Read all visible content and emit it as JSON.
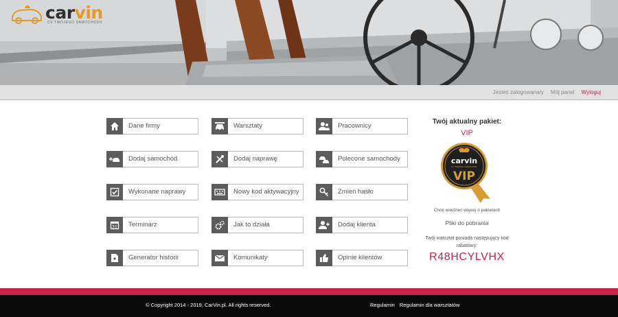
{
  "brand": {
    "name_prefix": "car",
    "name_accent": "vin",
    "tagline": "CV TWOJEGO SAMOCHODU"
  },
  "userbar": {
    "logged_in": "Jesteś zalogowana/y",
    "my_panel": "Mój panel",
    "logout": "Wyloguj"
  },
  "tiles": [
    {
      "label": "Dane firmy",
      "icon": "home-icon"
    },
    {
      "label": "Warsztaty",
      "icon": "car-service-icon"
    },
    {
      "label": "Pracownicy",
      "icon": "users-icon"
    },
    {
      "label": "Dodaj samochód",
      "icon": "add-car-icon"
    },
    {
      "label": "Dodaj naprawę",
      "icon": "tools-icon"
    },
    {
      "label": "Polecone samochody",
      "icon": "cars-icon"
    },
    {
      "label": "Wykonane naprawy",
      "icon": "checklist-icon"
    },
    {
      "label": "Nowy kod aktywacyjny",
      "icon": "keyboard-icon"
    },
    {
      "label": "Zmień hasło",
      "icon": "key-icon"
    },
    {
      "label": "Terminarz",
      "icon": "calendar-icon"
    },
    {
      "label": "Jak to działa",
      "icon": "gears-icon"
    },
    {
      "label": "Dodaj klienta",
      "icon": "add-user-icon"
    },
    {
      "label": "Generator historii",
      "icon": "document-icon"
    },
    {
      "label": "Komunikaty",
      "icon": "envelope-icon"
    },
    {
      "label": "Opinie klientów",
      "icon": "thumbs-up-icon"
    }
  ],
  "package": {
    "title": "Twój aktualny pakiet:",
    "name": "VIP",
    "badge_brand": "carvin",
    "badge_tagline": "CV TWOJEGO SAMOCHODU",
    "badge_text": "VIP",
    "more_info": "Chcę wiedzieć więcej o pakietach",
    "downloads": "Pliki do pobrania",
    "discount_text": "Twój warsztat posiada następujący kod rabatowy:",
    "discount_code": "R48HCYLVHX"
  },
  "footer": {
    "copyright": "© Copyright 2014 - 2019, CarVin.pl. All rights reserved.",
    "terms": "Regulamin",
    "terms_workshops": "Regulamin dla warsztatów"
  },
  "colors": {
    "accent": "#c4234a",
    "logo_orange": "#e29a2c",
    "tile_icon_bg": "#5c5c5c"
  }
}
